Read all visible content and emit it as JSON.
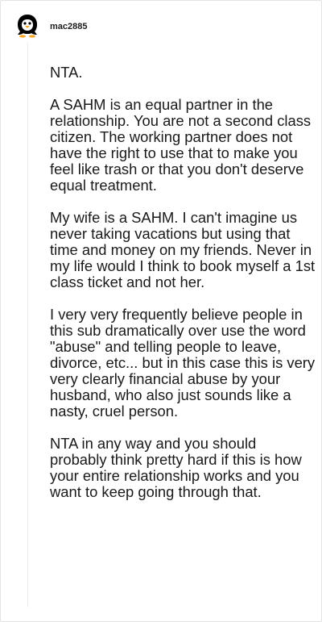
{
  "comment": {
    "username": "mac2885",
    "avatar_icon": "penguin-avatar-icon",
    "paragraphs": [
      "NTA.",
      "A SAHM is an equal partner in the relationship. You are not a second class citizen. The working partner does not have the right to use that to make you feel like trash or that you don't deserve equal treatment.",
      "My wife is a SAHM. I can't imagine us never taking vacations but using that time and money on my friends. Never in my life would I think to book myself a 1st class ticket and not her.",
      "I very very frequently believe people in this sub dramatically over use the word \"abuse\" and telling people to leave, divorce, etc... but in this case this is very very clearly financial abuse by your husband, who also just sounds like a nasty, cruel person.",
      "NTA in any way and you should probably think pretty hard if this is how your entire relationship works and you want to keep going through that."
    ]
  },
  "colors": {
    "text": "#1a1a1a",
    "thread_line": "#ececec",
    "avatar_bg": "#000000",
    "avatar_beak": "#f5a623"
  }
}
